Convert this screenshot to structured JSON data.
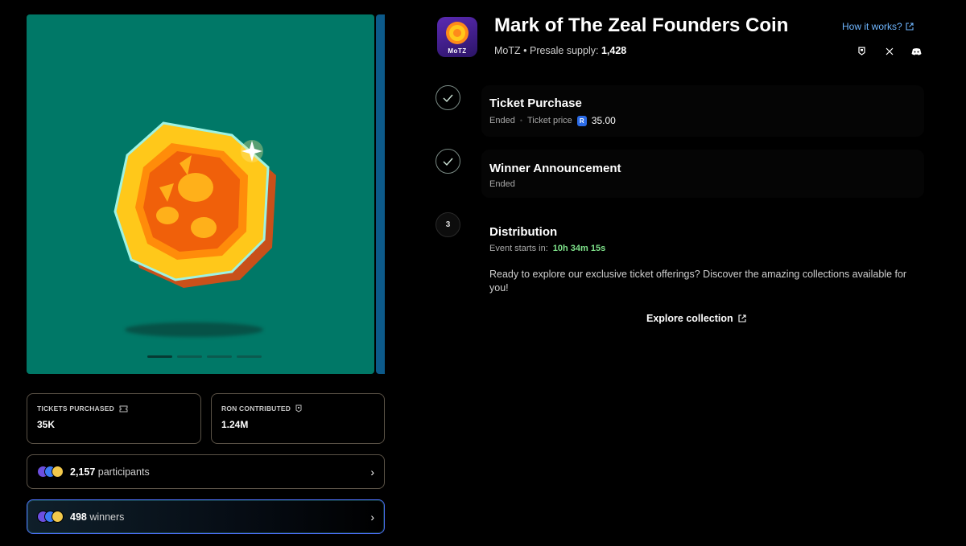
{
  "carousel": {
    "slide_count": 4,
    "active_index": 0
  },
  "stats": {
    "tickets": {
      "label": "TICKETS PURCHASED",
      "value": "35K"
    },
    "ron": {
      "label": "RON CONTRIBUTED",
      "value": "1.24M"
    }
  },
  "participants": {
    "count": "2,157",
    "label": "participants"
  },
  "winners": {
    "count": "498",
    "label": "winners"
  },
  "header": {
    "logo_text": "MoTZ",
    "title": "Mark of The Zeal Founders Coin",
    "ticker": "MoTZ",
    "supply_label": "Presale supply:",
    "supply_value": "1,428",
    "how_it_works": "How it works?"
  },
  "socials": [
    "ronin-icon",
    "x-icon",
    "discord-icon"
  ],
  "steps": {
    "purchase": {
      "title": "Ticket Purchase",
      "status": "Ended",
      "price_label": "Ticket price",
      "price": "35.00"
    },
    "announcement": {
      "title": "Winner Announcement",
      "status": "Ended"
    },
    "distribution": {
      "number": "3",
      "title": "Distribution",
      "starts_label": "Event starts in:",
      "countdown": "10h 34m 15s",
      "description": "Ready to explore our exclusive ticket offerings? Discover the amazing collections available for you!",
      "explore_label": "Explore collection"
    }
  },
  "colors": {
    "accent_link": "#6fb6ff",
    "countdown": "#7ee28a",
    "carousel_bg": "#007867",
    "winners_border": "#4a6cf0"
  }
}
